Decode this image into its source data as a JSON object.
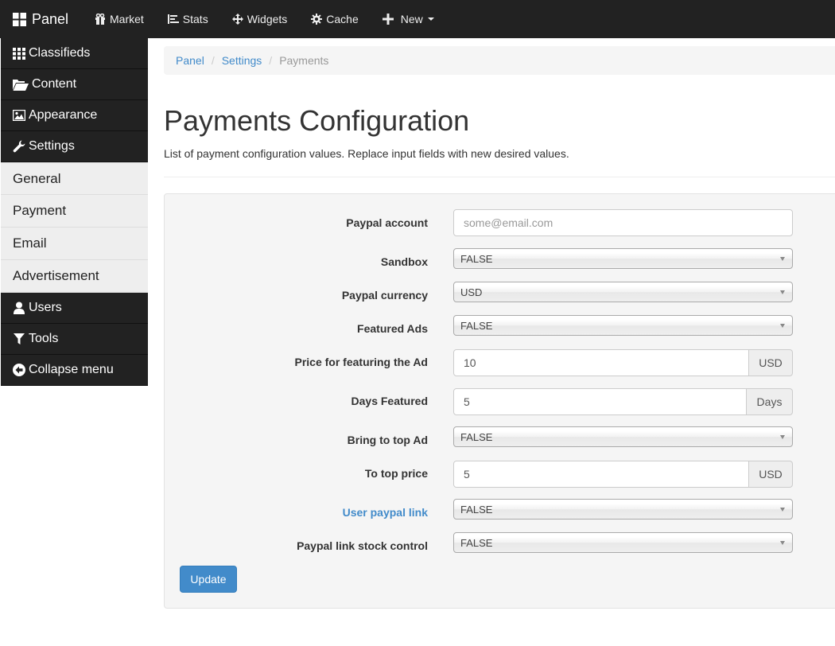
{
  "navbar": {
    "brand": "Panel",
    "items": [
      {
        "label": "Market",
        "icon": "gift-icon"
      },
      {
        "label": "Stats",
        "icon": "bar-chart-icon"
      },
      {
        "label": "Widgets",
        "icon": "move-icon"
      },
      {
        "label": "Cache",
        "icon": "gear-icon"
      },
      {
        "label": "New",
        "icon": "plus-icon"
      }
    ]
  },
  "sidebar": {
    "top": [
      {
        "label": "Classifieds",
        "icon": "grid-icon"
      },
      {
        "label": "Content",
        "icon": "folder-open-icon"
      },
      {
        "label": "Appearance",
        "icon": "picture-icon"
      },
      {
        "label": "Settings",
        "icon": "wrench-icon"
      }
    ],
    "sub": [
      "General",
      "Payment",
      "Email",
      "Advertisement"
    ],
    "bottom": [
      {
        "label": "Users",
        "icon": "user-icon"
      },
      {
        "label": "Tools",
        "icon": "filter-icon"
      },
      {
        "label": "Collapse menu",
        "icon": "circle-arrow-left-icon"
      }
    ]
  },
  "breadcrumb": {
    "items": [
      "Panel",
      "Settings"
    ],
    "active": "Payments"
  },
  "page": {
    "title": "Payments Configuration",
    "description": "List of payment configuration values. Replace input fields with new desired values."
  },
  "form": {
    "paypal_account": {
      "label": "Paypal account",
      "placeholder": "some@email.com"
    },
    "sandbox": {
      "label": "Sandbox",
      "value": "FALSE"
    },
    "paypal_currency": {
      "label": "Paypal currency",
      "value": "USD"
    },
    "featured_ads": {
      "label": "Featured Ads",
      "value": "FALSE"
    },
    "feature_price": {
      "label": "Price for featuring the Ad",
      "value": "10",
      "addon": "USD"
    },
    "days_featured": {
      "label": "Days Featured",
      "value": "5",
      "addon": "Days"
    },
    "bring_to_top": {
      "label": "Bring to top Ad",
      "value": "FALSE"
    },
    "to_top_price": {
      "label": "To top price",
      "value": "5",
      "addon": "USD"
    },
    "user_paypal_link": {
      "label": "User paypal link",
      "value": "FALSE"
    },
    "paypal_link_stock": {
      "label": "Paypal link stock control",
      "value": "FALSE"
    },
    "submit_label": "Update"
  },
  "colors": {
    "navbar_bg": "#222222",
    "link": "#428bca",
    "primary_button": "#428bca",
    "well_bg": "#f5f5f5"
  }
}
